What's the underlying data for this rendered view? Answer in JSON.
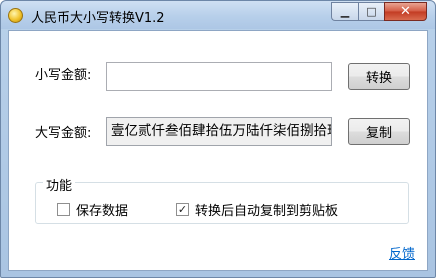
{
  "window": {
    "title": "人民币大小写转换V1.2"
  },
  "small_amount": {
    "label": "小写金额:",
    "value": "",
    "button": "转换"
  },
  "big_amount": {
    "label": "大写金额:",
    "value": "壹亿贰仟叁佰肆拾伍万陆仟柒佰捌拾玖元柒",
    "button": "复制"
  },
  "features": {
    "title": "功能",
    "save_data": {
      "label": "保存数据",
      "checked": false
    },
    "auto_copy": {
      "label": "转换后自动复制到剪贴板",
      "checked": true
    }
  },
  "feedback_link": "反馈"
}
